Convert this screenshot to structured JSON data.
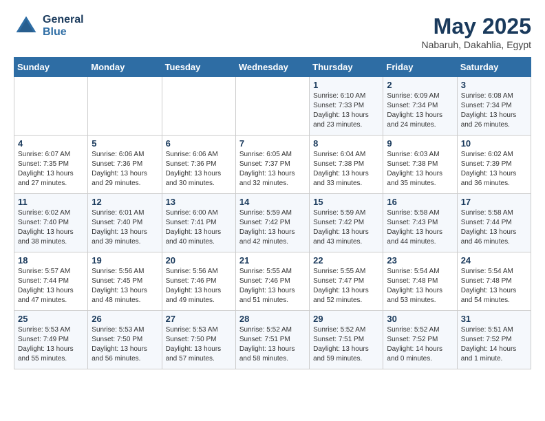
{
  "header": {
    "logo_general": "General",
    "logo_blue": "Blue",
    "month_title": "May 2025",
    "location": "Nabaruh, Dakahlia, Egypt"
  },
  "days_of_week": [
    "Sunday",
    "Monday",
    "Tuesday",
    "Wednesday",
    "Thursday",
    "Friday",
    "Saturday"
  ],
  "weeks": [
    [
      {
        "day": "",
        "info": ""
      },
      {
        "day": "",
        "info": ""
      },
      {
        "day": "",
        "info": ""
      },
      {
        "day": "",
        "info": ""
      },
      {
        "day": "1",
        "info": "Sunrise: 6:10 AM\nSunset: 7:33 PM\nDaylight: 13 hours\nand 23 minutes."
      },
      {
        "day": "2",
        "info": "Sunrise: 6:09 AM\nSunset: 7:34 PM\nDaylight: 13 hours\nand 24 minutes."
      },
      {
        "day": "3",
        "info": "Sunrise: 6:08 AM\nSunset: 7:34 PM\nDaylight: 13 hours\nand 26 minutes."
      }
    ],
    [
      {
        "day": "4",
        "info": "Sunrise: 6:07 AM\nSunset: 7:35 PM\nDaylight: 13 hours\nand 27 minutes."
      },
      {
        "day": "5",
        "info": "Sunrise: 6:06 AM\nSunset: 7:36 PM\nDaylight: 13 hours\nand 29 minutes."
      },
      {
        "day": "6",
        "info": "Sunrise: 6:06 AM\nSunset: 7:36 PM\nDaylight: 13 hours\nand 30 minutes."
      },
      {
        "day": "7",
        "info": "Sunrise: 6:05 AM\nSunset: 7:37 PM\nDaylight: 13 hours\nand 32 minutes."
      },
      {
        "day": "8",
        "info": "Sunrise: 6:04 AM\nSunset: 7:38 PM\nDaylight: 13 hours\nand 33 minutes."
      },
      {
        "day": "9",
        "info": "Sunrise: 6:03 AM\nSunset: 7:38 PM\nDaylight: 13 hours\nand 35 minutes."
      },
      {
        "day": "10",
        "info": "Sunrise: 6:02 AM\nSunset: 7:39 PM\nDaylight: 13 hours\nand 36 minutes."
      }
    ],
    [
      {
        "day": "11",
        "info": "Sunrise: 6:02 AM\nSunset: 7:40 PM\nDaylight: 13 hours\nand 38 minutes."
      },
      {
        "day": "12",
        "info": "Sunrise: 6:01 AM\nSunset: 7:40 PM\nDaylight: 13 hours\nand 39 minutes."
      },
      {
        "day": "13",
        "info": "Sunrise: 6:00 AM\nSunset: 7:41 PM\nDaylight: 13 hours\nand 40 minutes."
      },
      {
        "day": "14",
        "info": "Sunrise: 5:59 AM\nSunset: 7:42 PM\nDaylight: 13 hours\nand 42 minutes."
      },
      {
        "day": "15",
        "info": "Sunrise: 5:59 AM\nSunset: 7:42 PM\nDaylight: 13 hours\nand 43 minutes."
      },
      {
        "day": "16",
        "info": "Sunrise: 5:58 AM\nSunset: 7:43 PM\nDaylight: 13 hours\nand 44 minutes."
      },
      {
        "day": "17",
        "info": "Sunrise: 5:58 AM\nSunset: 7:44 PM\nDaylight: 13 hours\nand 46 minutes."
      }
    ],
    [
      {
        "day": "18",
        "info": "Sunrise: 5:57 AM\nSunset: 7:44 PM\nDaylight: 13 hours\nand 47 minutes."
      },
      {
        "day": "19",
        "info": "Sunrise: 5:56 AM\nSunset: 7:45 PM\nDaylight: 13 hours\nand 48 minutes."
      },
      {
        "day": "20",
        "info": "Sunrise: 5:56 AM\nSunset: 7:46 PM\nDaylight: 13 hours\nand 49 minutes."
      },
      {
        "day": "21",
        "info": "Sunrise: 5:55 AM\nSunset: 7:46 PM\nDaylight: 13 hours\nand 51 minutes."
      },
      {
        "day": "22",
        "info": "Sunrise: 5:55 AM\nSunset: 7:47 PM\nDaylight: 13 hours\nand 52 minutes."
      },
      {
        "day": "23",
        "info": "Sunrise: 5:54 AM\nSunset: 7:48 PM\nDaylight: 13 hours\nand 53 minutes."
      },
      {
        "day": "24",
        "info": "Sunrise: 5:54 AM\nSunset: 7:48 PM\nDaylight: 13 hours\nand 54 minutes."
      }
    ],
    [
      {
        "day": "25",
        "info": "Sunrise: 5:53 AM\nSunset: 7:49 PM\nDaylight: 13 hours\nand 55 minutes."
      },
      {
        "day": "26",
        "info": "Sunrise: 5:53 AM\nSunset: 7:50 PM\nDaylight: 13 hours\nand 56 minutes."
      },
      {
        "day": "27",
        "info": "Sunrise: 5:53 AM\nSunset: 7:50 PM\nDaylight: 13 hours\nand 57 minutes."
      },
      {
        "day": "28",
        "info": "Sunrise: 5:52 AM\nSunset: 7:51 PM\nDaylight: 13 hours\nand 58 minutes."
      },
      {
        "day": "29",
        "info": "Sunrise: 5:52 AM\nSunset: 7:51 PM\nDaylight: 13 hours\nand 59 minutes."
      },
      {
        "day": "30",
        "info": "Sunrise: 5:52 AM\nSunset: 7:52 PM\nDaylight: 14 hours\nand 0 minutes."
      },
      {
        "day": "31",
        "info": "Sunrise: 5:51 AM\nSunset: 7:52 PM\nDaylight: 14 hours\nand 1 minute."
      }
    ]
  ]
}
